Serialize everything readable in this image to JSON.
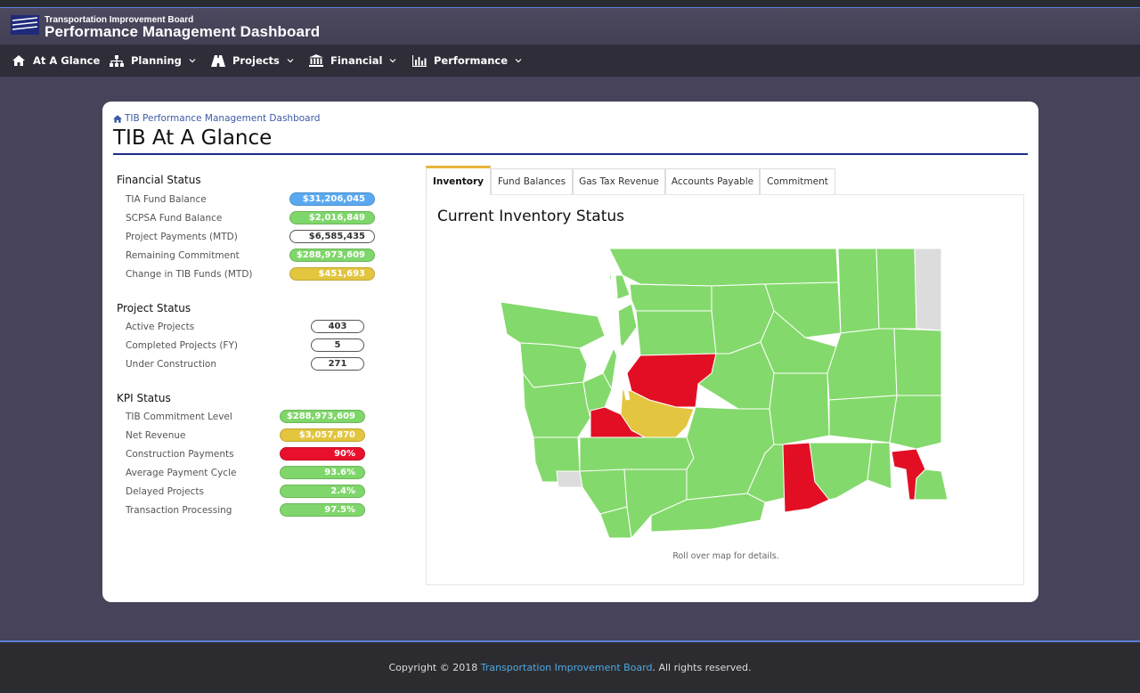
{
  "header": {
    "org_name": "Transportation Improvement Board",
    "app_title": "Performance Management Dashboard"
  },
  "nav": {
    "items": [
      {
        "label": "At A Glance",
        "icon": "home-icon",
        "has_dropdown": false
      },
      {
        "label": "Planning",
        "icon": "sitemap-icon",
        "has_dropdown": true
      },
      {
        "label": "Projects",
        "icon": "road-icon",
        "has_dropdown": true
      },
      {
        "label": "Financial",
        "icon": "bank-icon",
        "has_dropdown": true
      },
      {
        "label": "Performance",
        "icon": "bar-chart-icon",
        "has_dropdown": true
      }
    ]
  },
  "breadcrumb": "TIB Performance Management Dashboard",
  "page_title": "TIB At A Glance",
  "financial": {
    "heading": "Financial Status",
    "rows": [
      {
        "label": "TIA Fund Balance",
        "value": "$31,206,045",
        "color": "#5aa9f0"
      },
      {
        "label": "SCPSA Fund Balance",
        "value": "$2,016,849",
        "color": "#7fd66a"
      },
      {
        "label": "Project Payments (MTD)",
        "value": "$6,585,435",
        "color": "#ffffff"
      },
      {
        "label": "Remaining Commitment",
        "value": "$288,973,609",
        "color": "#7fd66a"
      },
      {
        "label": "Change in TIB Funds (MTD)",
        "value": "$451,693",
        "color": "#e3c53e"
      }
    ]
  },
  "project": {
    "heading": "Project Status",
    "rows": [
      {
        "label": "Active Projects",
        "value": "403"
      },
      {
        "label": "Completed Projects (FY)",
        "value": "5"
      },
      {
        "label": "Under Construction",
        "value": "271"
      }
    ]
  },
  "kpi": {
    "heading": "KPI Status",
    "rows": [
      {
        "label": "TIB Commitment Level",
        "value": "$288,973,609",
        "color": "#7fd66a"
      },
      {
        "label": "Net Revenue",
        "value": "$3,057,870",
        "color": "#e3c53e"
      },
      {
        "label": "Construction Payments",
        "value": "90%",
        "color": "#e8102c"
      },
      {
        "label": "Average Payment Cycle",
        "value": "93.6%",
        "color": "#7fd66a"
      },
      {
        "label": "Delayed Projects",
        "value": "2.4%",
        "color": "#7fd66a"
      },
      {
        "label": "Transaction Processing",
        "value": "97.5%",
        "color": "#7fd66a"
      }
    ]
  },
  "tabs": [
    "Inventory",
    "Fund Balances",
    "Gas Tax Revenue",
    "Accounts Payable",
    "Commitment"
  ],
  "active_tab": "Inventory",
  "panel_title": "Current Inventory Status",
  "map_note": "Roll over map for details.",
  "map_colors": {
    "green": "#84d96c",
    "red": "#e20f24",
    "yellow": "#e4c53f",
    "gray": "#dcdcdc"
  },
  "footer": {
    "prefix": "Copyright © 2018 ",
    "link": "Transportation Improvement Board",
    "suffix": ". All rights reserved."
  }
}
